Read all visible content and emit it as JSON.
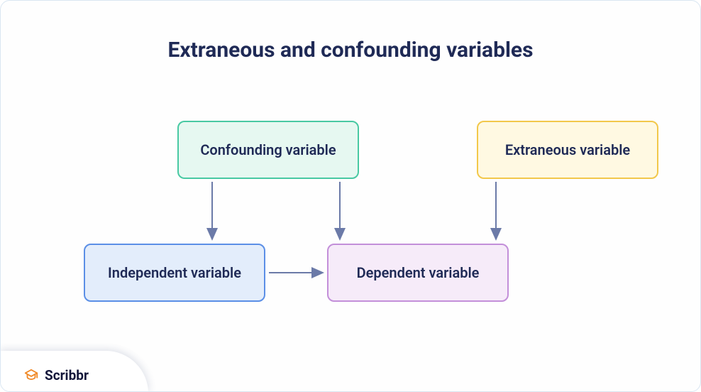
{
  "title": "Extraneous and confounding variables",
  "nodes": {
    "confounding": "Confounding variable",
    "extraneous": "Extraneous variable",
    "independent": "Independent variable",
    "dependent": "Dependent variable"
  },
  "edges": [
    {
      "from": "confounding",
      "to": "independent"
    },
    {
      "from": "confounding",
      "to": "dependent"
    },
    {
      "from": "extraneous",
      "to": "dependent"
    },
    {
      "from": "independent",
      "to": "dependent"
    }
  ],
  "brand": "Scribbr",
  "colors": {
    "text": "#1f2a56",
    "arrow": "#6b7aa8",
    "confounding_bg": "#e6f8f1",
    "confounding_border": "#49c9a3",
    "extraneous_bg": "#fff9e2",
    "extraneous_border": "#f2c84b",
    "independent_bg": "#e3edfb",
    "independent_border": "#5b8fe6",
    "dependent_bg": "#f6ebf9",
    "dependent_border": "#c38fd9",
    "brand_accent": "#f08a29"
  }
}
